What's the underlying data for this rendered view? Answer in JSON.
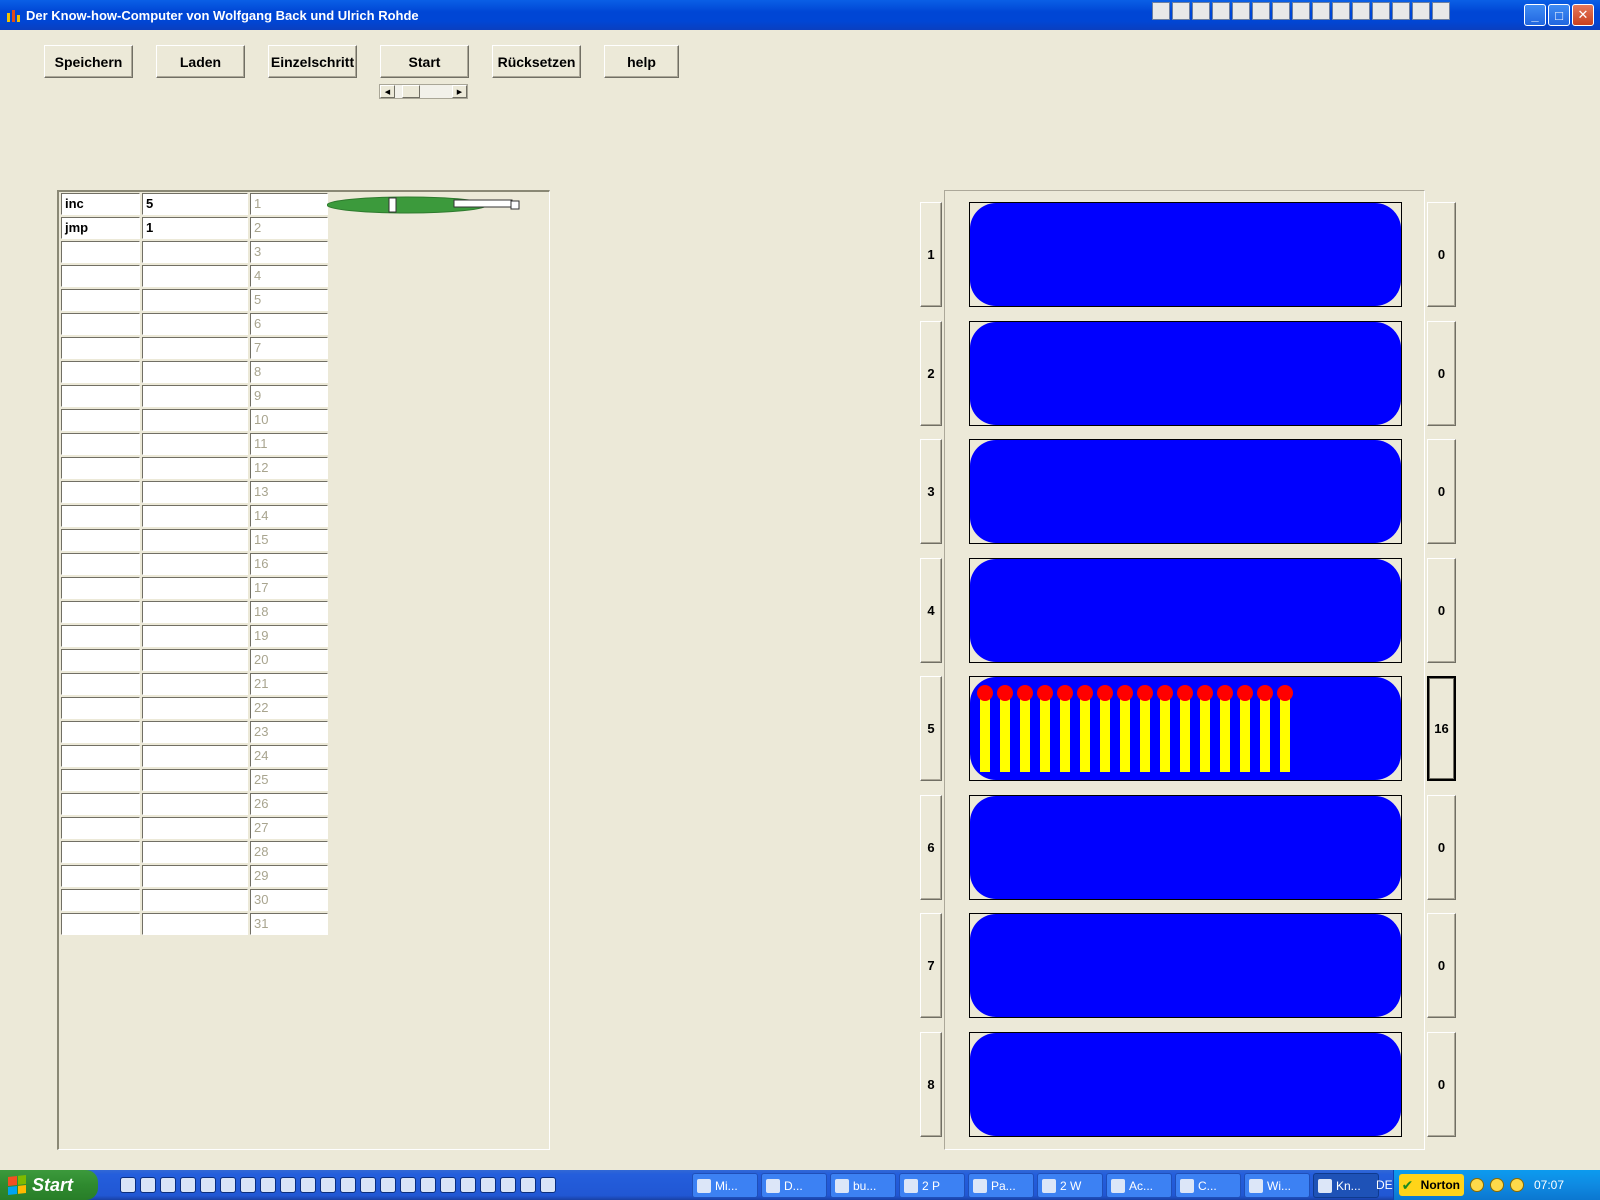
{
  "window": {
    "title": "Der Know-how-Computer von Wolfgang Back und Ulrich Rohde",
    "controls": [
      "_",
      "□",
      "✕"
    ]
  },
  "toolbar": {
    "buttons": [
      "Speichern",
      "Laden",
      "Einzelschritt",
      "Start",
      "Rücksetzen",
      "help"
    ],
    "speed_level": 0.3
  },
  "program": {
    "rows": [
      {
        "cmd": "inc",
        "arg": "5",
        "line": "1"
      },
      {
        "cmd": "jmp",
        "arg": "1",
        "line": "2"
      },
      {
        "cmd": "",
        "arg": "",
        "line": "3"
      },
      {
        "cmd": "",
        "arg": "",
        "line": "4"
      },
      {
        "cmd": "",
        "arg": "",
        "line": "5"
      },
      {
        "cmd": "",
        "arg": "",
        "line": "6"
      },
      {
        "cmd": "",
        "arg": "",
        "line": "7"
      },
      {
        "cmd": "",
        "arg": "",
        "line": "8"
      },
      {
        "cmd": "",
        "arg": "",
        "line": "9"
      },
      {
        "cmd": "",
        "arg": "",
        "line": "10"
      },
      {
        "cmd": "",
        "arg": "",
        "line": "11"
      },
      {
        "cmd": "",
        "arg": "",
        "line": "12"
      },
      {
        "cmd": "",
        "arg": "",
        "line": "13"
      },
      {
        "cmd": "",
        "arg": "",
        "line": "14"
      },
      {
        "cmd": "",
        "arg": "",
        "line": "15"
      },
      {
        "cmd": "",
        "arg": "",
        "line": "16"
      },
      {
        "cmd": "",
        "arg": "",
        "line": "17"
      },
      {
        "cmd": "",
        "arg": "",
        "line": "18"
      },
      {
        "cmd": "",
        "arg": "",
        "line": "19"
      },
      {
        "cmd": "",
        "arg": "",
        "line": "20"
      },
      {
        "cmd": "",
        "arg": "",
        "line": "21"
      },
      {
        "cmd": "",
        "arg": "",
        "line": "22"
      },
      {
        "cmd": "",
        "arg": "",
        "line": "23"
      },
      {
        "cmd": "",
        "arg": "",
        "line": "24"
      },
      {
        "cmd": "",
        "arg": "",
        "line": "25"
      },
      {
        "cmd": "",
        "arg": "",
        "line": "26"
      },
      {
        "cmd": "",
        "arg": "",
        "line": "27"
      },
      {
        "cmd": "",
        "arg": "",
        "line": "28"
      },
      {
        "cmd": "",
        "arg": "",
        "line": "29"
      },
      {
        "cmd": "",
        "arg": "",
        "line": "30"
      },
      {
        "cmd": "",
        "arg": "",
        "line": "31"
      }
    ],
    "program_counter_line": 1
  },
  "registers": [
    {
      "label": "1",
      "count": "0"
    },
    {
      "label": "2",
      "count": "0"
    },
    {
      "label": "3",
      "count": "0"
    },
    {
      "label": "4",
      "count": "0"
    },
    {
      "label": "5",
      "count": "16",
      "active": true
    },
    {
      "label": "6",
      "count": "0"
    },
    {
      "label": "7",
      "count": "0"
    },
    {
      "label": "8",
      "count": "0"
    }
  ],
  "colors": {
    "register_tube": "#0000FF",
    "match_stick": "#FFFF00",
    "match_head": "#FF0000",
    "pen": "#3C9A3C"
  },
  "taskbar": {
    "start_label": "Start",
    "tasks": [
      "Mi...",
      "D...",
      "bu...",
      "2 P",
      "Pa...",
      "2 W",
      "Ac...",
      "C...",
      "Wi...",
      "Kn..."
    ],
    "language": "DE",
    "norton_label": "Norton",
    "clock": "07:07"
  }
}
